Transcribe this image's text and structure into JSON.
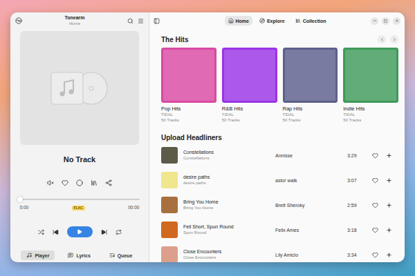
{
  "window": {
    "title": "Tonearm",
    "subtitle": "Home"
  },
  "header_tabs": [
    {
      "label": "Home",
      "selected": true
    },
    {
      "label": "Explore",
      "selected": false
    },
    {
      "label": "Collection",
      "selected": false
    }
  ],
  "player": {
    "track": "No Track",
    "muted": true,
    "liked": false,
    "level": 0,
    "elapsed": "0:00",
    "duration": "00:00",
    "badge": "FLAC",
    "playing": false
  },
  "player_tabs": [
    {
      "label": "Player",
      "selected": true
    },
    {
      "label": "Lyrics",
      "selected": false
    },
    {
      "label": "Queue",
      "selected": false
    }
  ],
  "hits": {
    "title": "The Hits",
    "cards": [
      {
        "title": "Pop Hits",
        "source": "TIDAL",
        "count": "50 Tracks",
        "color": "#d94aa3"
      },
      {
        "title": "R&B Hits",
        "source": "TIDAL",
        "count": "50 Tracks",
        "color": "#9a34e6"
      },
      {
        "title": "Rap Hits",
        "source": "TIDAL",
        "count": "50 Tracks",
        "color": "#5c608c"
      },
      {
        "title": "Indie Hits",
        "source": "TIDAL",
        "count": "50 Tracks",
        "color": "#3f9a5a"
      }
    ]
  },
  "headliners": {
    "title": "Upload Headliners",
    "tracks": [
      {
        "title": "Constellations",
        "album": "Constellations",
        "artist": "Annisse",
        "duration": "3:29",
        "liked": false,
        "color": "#5d5a48"
      },
      {
        "title": "desire paths",
        "album": "desire paths",
        "artist": "astor walk",
        "duration": "3:07",
        "liked": false,
        "color": "#efe68e"
      },
      {
        "title": "Bring You Home",
        "album": "Bring You Home",
        "artist": "Brett Sheroky",
        "duration": "2:59",
        "liked": false,
        "color": "#a8703f"
      },
      {
        "title": "Fell Short, Spun Round",
        "album": "Spun Round",
        "artist": "Felix Ames",
        "duration": "3:18",
        "liked": false,
        "color": "#d0681f"
      },
      {
        "title": "Close Encounters",
        "album": "Close Encounters",
        "artist": "Lily Amiclo",
        "duration": "3:34",
        "liked": false,
        "color": "#dc9f8c"
      }
    ]
  }
}
